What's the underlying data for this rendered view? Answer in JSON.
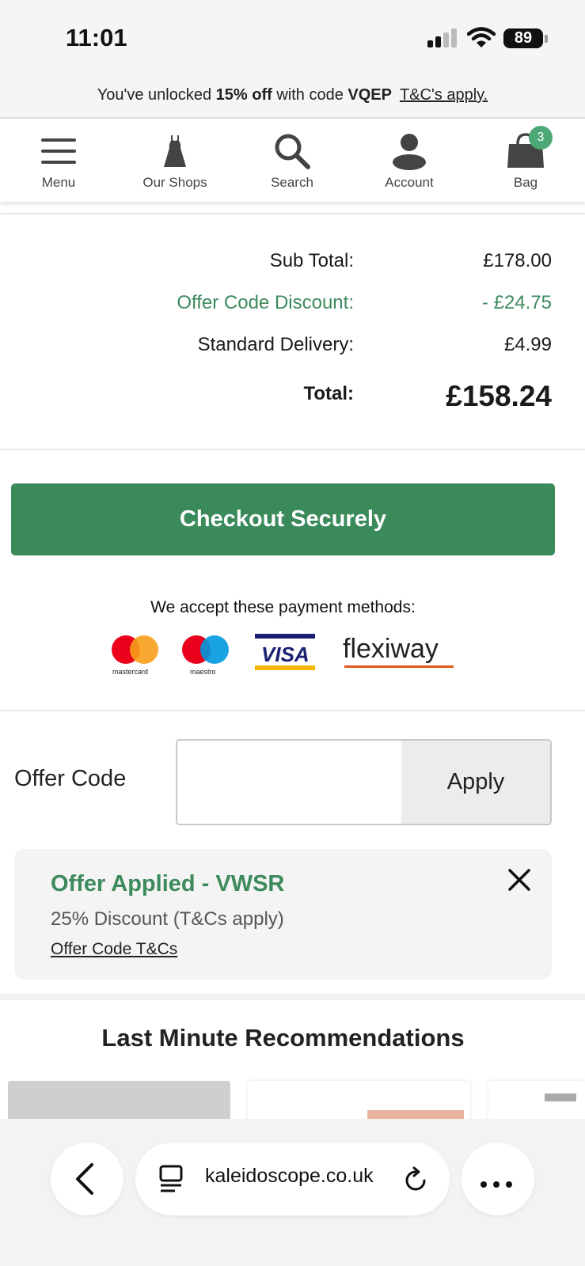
{
  "status_bar": {
    "time": "11:01",
    "battery": "89"
  },
  "promo": {
    "prefix": "You've unlocked ",
    "discount": "15% off",
    "middle": " with code ",
    "code": "VQEP",
    "tc_link": "T&C's apply."
  },
  "nav": {
    "items": [
      {
        "label": "Menu",
        "icon": "hamburger-icon"
      },
      {
        "label": "Our Shops",
        "icon": "dress-icon"
      },
      {
        "label": "Search",
        "icon": "search-icon"
      },
      {
        "label": "Account",
        "icon": "user-icon"
      },
      {
        "label": "Bag",
        "icon": "bag-icon"
      }
    ],
    "bag_count": "3"
  },
  "totals": {
    "subtotal_label": "Sub Total:",
    "subtotal_value": "£178.00",
    "discount_label": "Offer Code Discount:",
    "discount_value": "- £24.75",
    "delivery_label": "Standard Delivery:",
    "delivery_value": "£4.99",
    "total_label": "Total:",
    "total_value": "£158.24"
  },
  "checkout": {
    "label": "Checkout Securely"
  },
  "payment": {
    "text": "We accept these payment methods:",
    "methods": [
      "mastercard",
      "maestro",
      "VISA",
      "flexiway"
    ],
    "colors": {
      "mc_red": "#eb001b",
      "mc_orange": "#f79e1b",
      "maestro_blue": "#0099df",
      "visa_blue": "#1a1f71",
      "visa_gold": "#f7b600",
      "flexiway_orange": "#e05a1c"
    }
  },
  "offer": {
    "label": "Offer Code",
    "input_value": "",
    "apply_label": "Apply"
  },
  "applied": {
    "title": "Offer Applied - VWSR",
    "subtitle": "25% Discount (T&Cs apply)",
    "link": "Offer Code T&Cs"
  },
  "recommendations": {
    "title": "Last Minute Recommendations"
  },
  "browser": {
    "url": "kaleidoscope.co.uk"
  },
  "colors": {
    "brand_green": "#3a8a5b",
    "badge_green": "#4ca874"
  }
}
